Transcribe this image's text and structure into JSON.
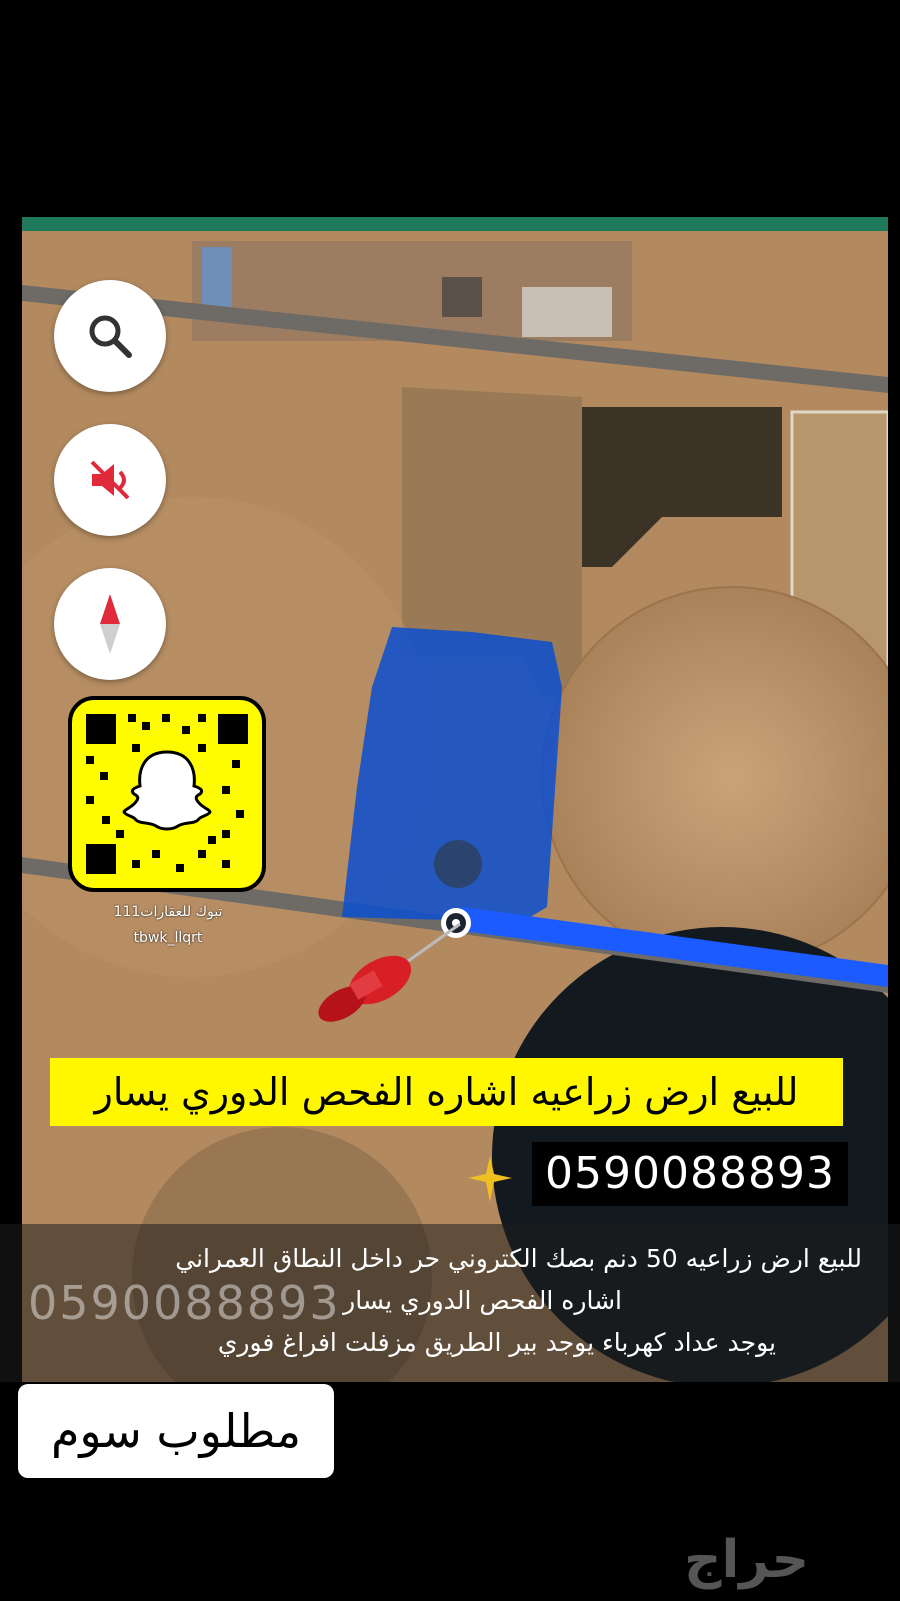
{
  "map_controls": {
    "search_icon": "search-icon",
    "sound_icon": "sound-off-icon",
    "compass_icon": "compass-icon"
  },
  "snapchat": {
    "icon": "snapchat-ghost-icon",
    "name": "تبوك للعقارات111",
    "handle": "tbwk_llqrt"
  },
  "headline": "للبيع ارض زراعيه اشاره الفحص الدوري يسار",
  "phone": "0590088893",
  "watermark_phone": "0590088893",
  "description": {
    "line1": "للبيع ارض زراعيه 50 دنم بصك الكتروني حر داخل النطاق العمراني",
    "line2": "اشاره الفحص الدوري يسار",
    "line3": "يوجد عداد كهرباء يوجد بير الطريق مزفلت افراغ فوري"
  },
  "price_label": "مطلوب سوم",
  "site_logo": "حراج",
  "colors": {
    "headline_bg": "#fff700",
    "snap_yellow": "#fffc00",
    "parcel_blue": "#0a4fd0",
    "route_blue": "#1c5bff"
  }
}
